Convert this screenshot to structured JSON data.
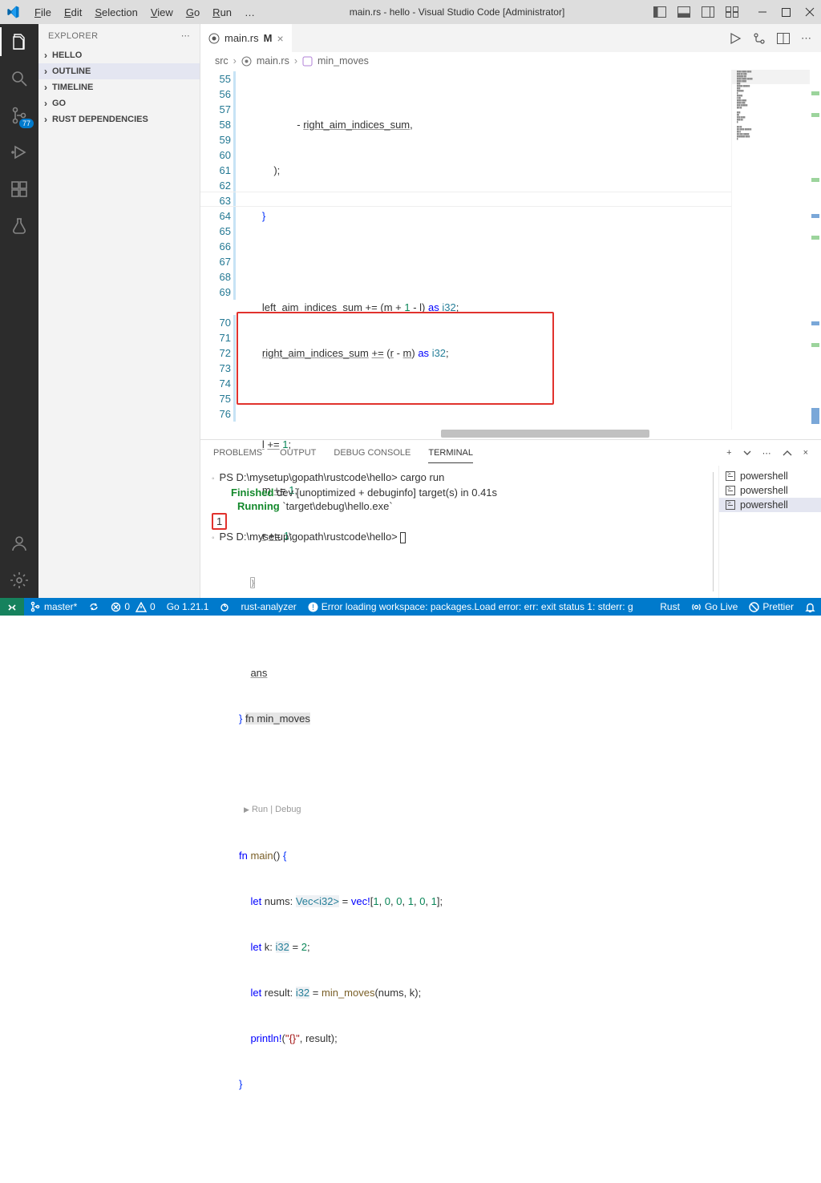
{
  "window": {
    "title": "main.rs - hello - Visual Studio Code [Administrator]",
    "menus": [
      "File",
      "Edit",
      "Selection",
      "View",
      "Go",
      "Run",
      "…"
    ]
  },
  "activity": {
    "badge": "77"
  },
  "explorer": {
    "title": "EXPLORER",
    "sections": [
      "HELLO",
      "OUTLINE",
      "TIMELINE",
      "GO",
      "RUST DEPENDENCIES"
    ]
  },
  "tab": {
    "filename": "main.rs",
    "dirty": "M"
  },
  "breadcrumbs": {
    "a": "src",
    "b": "main.rs",
    "c": "min_moves"
  },
  "gutter_start": 55,
  "lines": {
    "l55": "                    - right_aim_indices_sum,",
    "l56": "            );",
    "l57": "        }",
    "l58": "",
    "l59a": "        left_aim_indices_sum",
    "l59b": " += (",
    "l59c": "m",
    "l59d": " + ",
    "l59e": "1",
    "l59f": " - ",
    "l59g": "l",
    "l59h": ") as ",
    "l59i": "i32",
    "l59j": ";",
    "l60a": "        right_aim_indices_sum",
    "l60b": " += (",
    "l60c": "r",
    "l60d": " - ",
    "l60e": "m",
    "l60f": ") as ",
    "l60g": "i32",
    "l60h": ";",
    "l62a": "        l",
    "l62b": " += ",
    "l62c": "1",
    "l62d": ";",
    "l63a": "        m",
    "l63b": " += ",
    "l63c": "1",
    "l63d": ";",
    "l64a": "        r",
    "l64b": " += ",
    "l64c": "1",
    "l64d": ";",
    "l65": "    }",
    "l67": "    ans",
    "l68a": "} ",
    "l68sig": "fn min_moves",
    "codelens": "Run | Debug",
    "l70a": "fn",
    "l70b": " main",
    "l70c": "() {",
    "l71a": "    let",
    "l71b": " nums: ",
    "l71c": "Vec<i32>",
    "l71d": " = ",
    "l71e": "vec!",
    "l71f": "[",
    "l71g": "1, 0, 0, 1, 0, 1",
    "l71h": "];",
    "l72a": "    let",
    "l72b": " k: ",
    "l72c": "i32",
    "l72d": " = ",
    "l72e": "2",
    "l72f": ";",
    "l73a": "    let",
    "l73b": " result: ",
    "l73c": "i32",
    "l73d": " = ",
    "l73e": "min_moves",
    "l73f": "(nums, k);",
    "l74a": "    println!",
    "l74b": "(",
    "l74c": "\"{}\"",
    "l74d": ", result);",
    "l75": "}"
  },
  "panel": {
    "tabs": [
      "PROBLEMS",
      "OUTPUT",
      "DEBUG CONSOLE",
      "TERMINAL"
    ],
    "terminals": [
      "powershell",
      "powershell",
      "powershell"
    ],
    "t_prompt1": "PS D:\\mysetup\\gopath\\rustcode\\hello> ",
    "t_cmd": "cargo run",
    "t_finished_label": "Finished",
    "t_finished_rest": " dev [unoptimized + debuginfo] target(s) in 0.41s",
    "t_running_label": "Running",
    "t_running_rest": " `target\\debug\\hello.exe`",
    "t_output": "1",
    "t_prompt2": "PS D:\\mysetup\\gopath\\rustcode\\hello> "
  },
  "status": {
    "branch": "master*",
    "sync": "",
    "errors": "0",
    "warnings": "0",
    "go": "Go 1.21.1",
    "rust_analyzer": "rust-analyzer",
    "err_msg": "Error loading workspace: packages.Load error: err: exit status 1: stderr: g",
    "lang": "Rust",
    "golive": "Go Live",
    "prettier": "Prettier"
  }
}
